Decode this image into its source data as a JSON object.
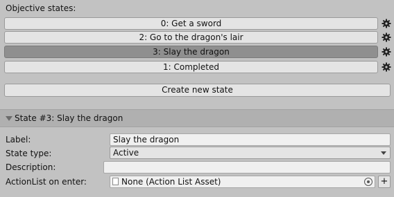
{
  "objective_states": {
    "title": "Objective states:",
    "states": [
      {
        "label": "0: Get a sword",
        "selected": false
      },
      {
        "label": "2: Go to the dragon's lair",
        "selected": false
      },
      {
        "label": "3: Slay the dragon",
        "selected": true
      },
      {
        "label": "1: Completed",
        "selected": false
      }
    ],
    "create_button": "Create new state"
  },
  "state_panel": {
    "header": "State #3: Slay the dragon",
    "label_caption": "Label:",
    "label_value": "Slay the dragon",
    "state_type_caption": "State type:",
    "state_type_value": "Active",
    "description_caption": "Description:",
    "description_value": "",
    "actionlist_caption": "ActionList on enter:",
    "actionlist_value": "None (Action List Asset)",
    "add_label": "+"
  },
  "icons": {
    "gear": "gear-icon",
    "foldout": "foldout-triangle-icon",
    "asset": "document-icon",
    "picker": "object-picker-icon"
  },
  "colors": {
    "background": "#c2c2c2",
    "button": "#e4e4e4",
    "selected_button": "#8f8f8f",
    "header": "#b0b0b0"
  }
}
